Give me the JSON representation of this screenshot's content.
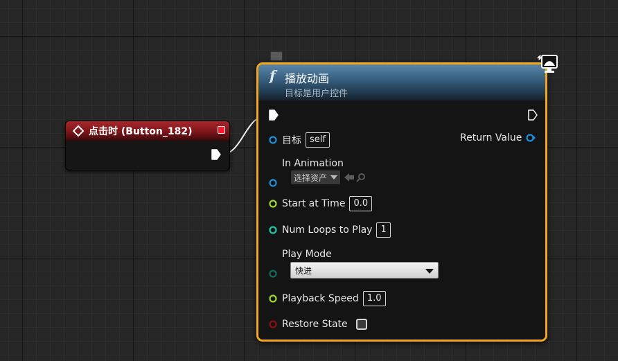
{
  "event_node": {
    "title": "点击时 (Button_182)",
    "header_color": "#8b1a1f"
  },
  "function_node": {
    "title": "播放动画",
    "subtitle": "目标是用户控件",
    "border_color": "#f4a71a",
    "header_color": "#3c6585",
    "icons": {
      "function": "f",
      "network": "monitor-icon",
      "comment": "comment-bubble-icon"
    },
    "pins": {
      "target": {
        "label": "目标",
        "value": "self",
        "color": "#1e8fd6"
      },
      "in_animation": {
        "label": "In Animation",
        "asset_placeholder": "选择资产",
        "color": "#1e8fd6"
      },
      "start_at_time": {
        "label": "Start at Time",
        "value": "0.0",
        "color": "#9ed62b"
      },
      "num_loops": {
        "label": "Num Loops to Play",
        "value": "1",
        "color": "#1ec9a8"
      },
      "play_mode": {
        "label": "Play Mode",
        "value": "快进",
        "color": "#0f6b5b"
      },
      "playback_speed": {
        "label": "Playback Speed",
        "value": "1.0",
        "color": "#9ed62b"
      },
      "restore_state": {
        "label": "Restore State",
        "checked": false,
        "color": "#8a1010"
      },
      "return_value": {
        "label": "Return Value",
        "color": "#1e8fd6"
      }
    }
  }
}
